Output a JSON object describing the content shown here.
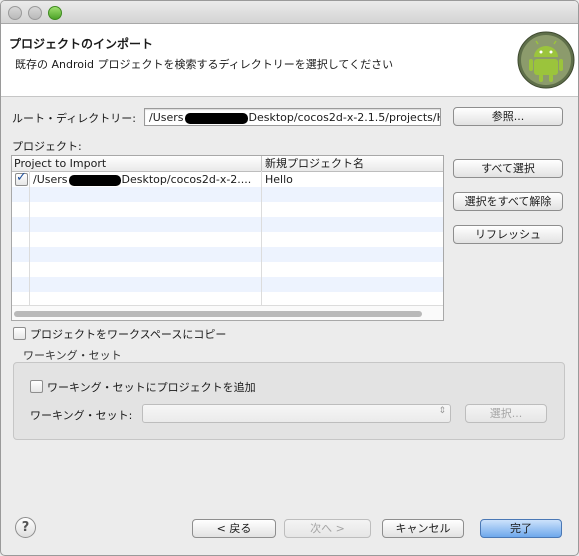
{
  "window": {
    "dialog_title": "プロジェクトのインポート",
    "description": "既存の Android プロジェクトを検索するディレクトリーを選択してください"
  },
  "root_directory": {
    "label": "ルート・ディレクトリー:",
    "value_prefix": "/Users",
    "value_suffix": "Desktop/cocos2d-x-2.1.5/projects/H",
    "browse_label": "参照..."
  },
  "projects": {
    "label": "プロジェクト:",
    "columns": [
      "Project to Import",
      "新規プロジェクト名"
    ],
    "rows": [
      {
        "checked": true,
        "path_prefix": "/Users",
        "path_suffix": "Desktop/cocos2d-x-2....",
        "new_name": "Hello"
      }
    ]
  },
  "side_buttons": {
    "select_all": "すべて選択",
    "deselect_all": "選択をすべて解除",
    "refresh": "リフレッシュ"
  },
  "copy_to_workspace": {
    "label": "プロジェクトをワークスペースにコピー",
    "checked": false
  },
  "working_set": {
    "group_title": "ワーキング・セット",
    "add_label": "ワーキング・セットにプロジェクトを追加",
    "add_checked": false,
    "field_label": "ワーキング・セット:",
    "select_label": "選択..."
  },
  "footer": {
    "help": "?",
    "back": "< 戻る",
    "next": "次へ >",
    "cancel": "キャンセル",
    "finish": "完了"
  },
  "colors": {
    "accent": "#6ea8ec",
    "android_green": "#9bc43c",
    "selection_row": "#edf3fe"
  },
  "icons": [
    "android-logo-icon",
    "checkmark-icon",
    "help-icon",
    "chevron-updown-icon"
  ]
}
